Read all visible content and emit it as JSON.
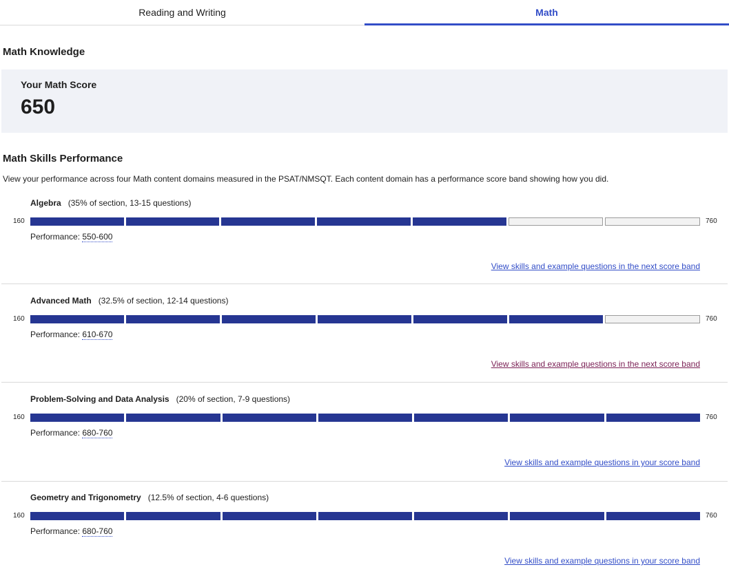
{
  "tabs": [
    {
      "label": "Reading and Writing",
      "active": false
    },
    {
      "label": "Math",
      "active": true
    }
  ],
  "math_knowledge": {
    "title": "Math Knowledge",
    "score_label": "Your Math Score",
    "score": "650"
  },
  "skills": {
    "title": "Math Skills Performance",
    "description": "View your performance across four Math content domains measured in the PSAT/NMSQT.  Each content domain has a performance score band showing how you did.",
    "scale_min": "160",
    "scale_max": "760",
    "performance_prefix": "Performance: ",
    "domains": [
      {
        "name": "Algebra",
        "meta": "(35% of section, 13-15 questions)",
        "filled_segments": 5,
        "total_segments": 7,
        "performance": "550-600",
        "link": "View skills and example questions in the next score band"
      },
      {
        "name": "Advanced Math",
        "meta": "(32.5% of section, 12-14 questions)",
        "filled_segments": 6,
        "total_segments": 7,
        "performance": "610-670",
        "link": "View skills and example questions in the next score band"
      },
      {
        "name": "Problem-Solving and Data Analysis",
        "meta": "(20% of section, 7-9 questions)",
        "filled_segments": 7,
        "total_segments": 7,
        "performance": "680-760",
        "link": "View skills and example questions in your score band"
      },
      {
        "name": "Geometry and Trigonometry",
        "meta": "(12.5% of section, 4-6 questions)",
        "filled_segments": 7,
        "total_segments": 7,
        "performance": "680-760",
        "link": "View skills and example questions in your score band"
      }
    ]
  },
  "colors": {
    "accent": "#324dc7",
    "bar_filled": "#263692",
    "bar_empty": "#f2f2f2",
    "visited_link": "#7a1f54"
  }
}
